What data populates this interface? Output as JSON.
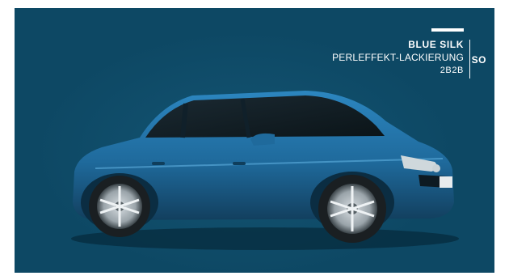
{
  "swatch": {
    "name": "BLUE SILK",
    "type": "PERLEFFEKT-LACKIERUNG",
    "code": "2B2B",
    "short_code": "SO"
  },
  "colors": {
    "background": "#0d4864",
    "car_paint": "#1f6a9c",
    "text": "#ffffff"
  },
  "car": {
    "icon": "hatchback-car-illustration"
  }
}
